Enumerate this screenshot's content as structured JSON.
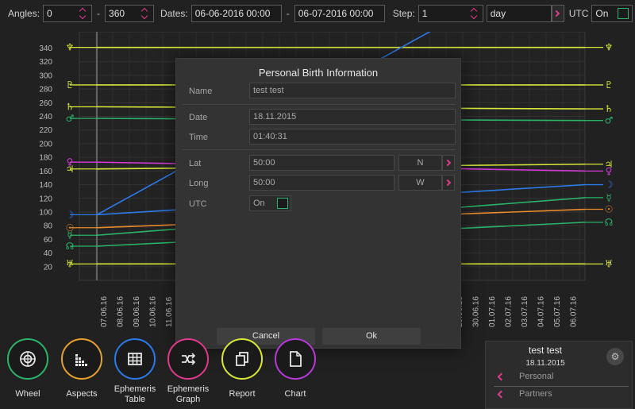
{
  "toolbar": {
    "angles_label": "Angles:",
    "angle_from": "0",
    "angle_to": "360",
    "dates_label": "Dates:",
    "date_from": "06-06-2016 00:00",
    "date_to": "06-07-2016 00:00",
    "step_label": "Step:",
    "step_value": "1",
    "step_unit": "day",
    "utc_label": "UTC",
    "utc_value": "On",
    "dash": "-"
  },
  "chart_data": {
    "type": "line",
    "ylim": [
      0,
      360
    ],
    "yticks": [
      20,
      40,
      60,
      80,
      100,
      120,
      140,
      160,
      180,
      200,
      220,
      240,
      260,
      280,
      300,
      320,
      340
    ],
    "x_labels_left": [
      "07.06.16",
      "08.06.16",
      "09.06.16",
      "10.06.16",
      "11.06.16"
    ],
    "x_labels_right": [
      "29.06.16",
      "30.06.16",
      "01.07.16",
      "02.07.16",
      "03.07.16",
      "04.07.16",
      "05.07.16",
      "06.07.16"
    ],
    "series": [
      {
        "planet": "neptune",
        "glyph": "♆",
        "color": "#d8e83a",
        "start": 341,
        "end": 341
      },
      {
        "planet": "pluto",
        "glyph": "♇",
        "color": "#d8e83a",
        "start": 286,
        "end": 286
      },
      {
        "planet": "saturn",
        "glyph": "♄",
        "color": "#d8e83a",
        "start": 254,
        "end": 251
      },
      {
        "planet": "mars",
        "glyph": "♂",
        "color": "#2bb36a",
        "start": 237,
        "end": 234
      },
      {
        "planet": "venus",
        "glyph": "♀",
        "color": "#d33ad8",
        "start": 173,
        "end": 160
      },
      {
        "planet": "jupiter",
        "glyph": "♃",
        "color": "#d8e83a",
        "start": 163,
        "end": 170
      },
      {
        "planet": "moon",
        "glyph": "☽",
        "color": "#2b7ae8",
        "start": 96,
        "end": 140
      },
      {
        "planet": "sun",
        "glyph": "☉",
        "color": "#e88a2b",
        "start": 77,
        "end": 104
      },
      {
        "planet": "mercury",
        "glyph": "☿",
        "color": "#2bb36a",
        "start": 66,
        "end": 121
      },
      {
        "planet": "node",
        "glyph": "☊",
        "color": "#2bb36a",
        "start": 50,
        "end": 85
      },
      {
        "planet": "uranus",
        "glyph": "♅",
        "color": "#d8e83a",
        "start": 24,
        "end": 24
      }
    ]
  },
  "modal": {
    "title": "Personal Birth Information",
    "name_label": "Name",
    "name_value": "test test",
    "date_label": "Date",
    "date_value": "18.11.2015",
    "time_label": "Time",
    "time_value": "01:40:31",
    "lat_label": "Lat",
    "lat_value": "50:00",
    "lat_dir": "N",
    "long_label": "Long",
    "long_value": "50:00",
    "long_dir": "W",
    "utc_label": "UTC",
    "utc_value": "On",
    "cancel_label": "Cancel",
    "ok_label": "Ok"
  },
  "nav": {
    "wheel": "Wheel",
    "aspects": "Aspects",
    "ephemeris_table": "Ephemeris Table",
    "ephemeris_graph": "Ephemeris Graph",
    "report": "Report",
    "chart": "Chart",
    "colors": {
      "wheel": "#2bb36a",
      "aspects": "#e8a22b",
      "ephemeris_table": "#2b7ae8",
      "ephemeris_graph": "#e13a8a",
      "report": "#d8e83a",
      "chart": "#b53ad8"
    }
  },
  "profile": {
    "name": "test test",
    "date": "18.11.2015",
    "personal": "Personal",
    "partners": "Partners"
  }
}
